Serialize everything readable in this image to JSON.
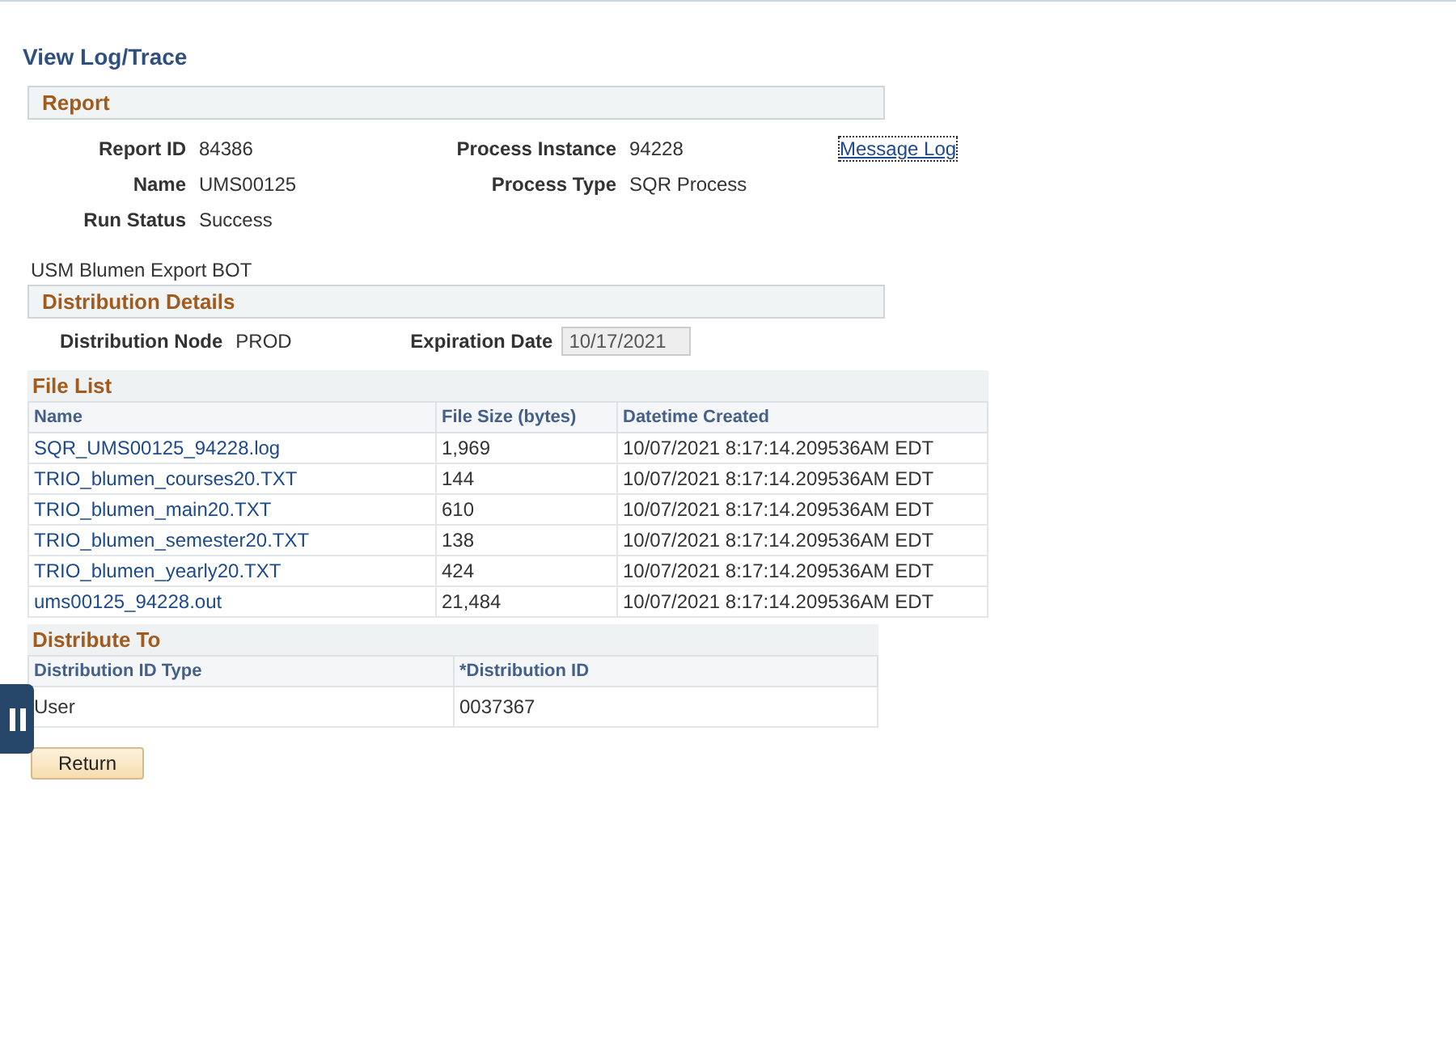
{
  "title": "View Log/Trace",
  "report": {
    "heading": "Report",
    "fields": [
      {
        "label": "Report ID",
        "value": "84386"
      },
      {
        "label": "Process Instance",
        "value": "94228"
      },
      {
        "label": "Name",
        "value": "UMS00125"
      },
      {
        "label": "Process Type",
        "value": "SQR Process"
      },
      {
        "label": "Run Status",
        "value": "Success"
      }
    ],
    "link": "Message Log"
  },
  "description": "USM Blumen Export BOT",
  "distribution_details": {
    "heading": "Distribution Details",
    "node_label": "Distribution Node",
    "node_value": "PROD",
    "expiration_label": "Expiration Date",
    "expiration_value": "10/17/2021"
  },
  "file_list": {
    "heading": "File List",
    "columns": [
      "Name",
      "File Size (bytes)",
      "Datetime Created"
    ],
    "rows": [
      {
        "name": "SQR_UMS00125_94228.log",
        "size": "1,969",
        "created": "10/07/2021  8:17:14.209536AM EDT"
      },
      {
        "name": "TRIO_blumen_courses20.TXT",
        "size": "144",
        "created": "10/07/2021  8:17:14.209536AM EDT"
      },
      {
        "name": "TRIO_blumen_main20.TXT",
        "size": "610",
        "created": "10/07/2021  8:17:14.209536AM EDT"
      },
      {
        "name": "TRIO_blumen_semester20.TXT",
        "size": "138",
        "created": "10/07/2021  8:17:14.209536AM EDT"
      },
      {
        "name": "TRIO_blumen_yearly20.TXT",
        "size": "424",
        "created": "10/07/2021  8:17:14.209536AM EDT"
      },
      {
        "name": "ums00125_94228.out",
        "size": "21,484",
        "created": "10/07/2021  8:17:14.209536AM EDT"
      }
    ]
  },
  "distribute_to": {
    "heading": "Distribute To",
    "columns": [
      "Distribution ID Type",
      "*Distribution ID"
    ],
    "rows": [
      {
        "type": "User",
        "id": "0037367"
      }
    ]
  },
  "return_button": "Return"
}
